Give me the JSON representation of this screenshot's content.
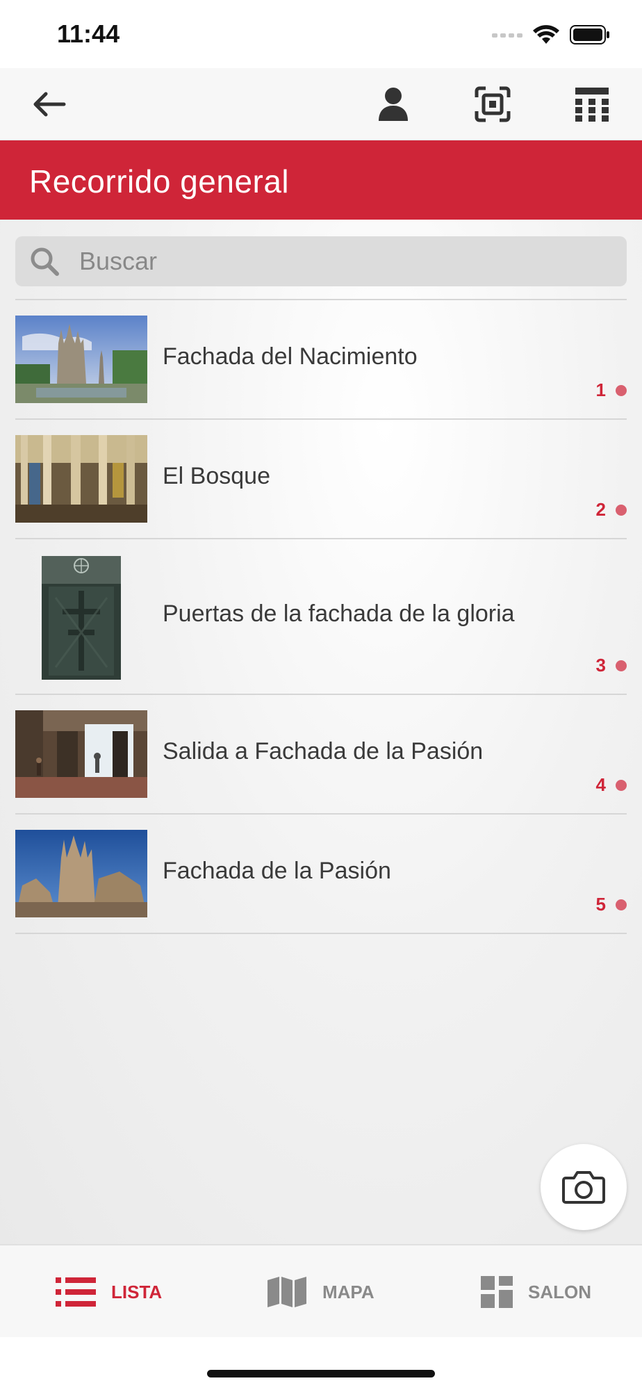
{
  "status_bar": {
    "time": "11:44"
  },
  "title_bar": {
    "title": "Recorrido general"
  },
  "search": {
    "placeholder": "Buscar"
  },
  "stops": [
    {
      "label": "Fachada del Nacimiento",
      "number": "1"
    },
    {
      "label": "El Bosque",
      "number": "2"
    },
    {
      "label": "Puertas de la fachada de la gloria",
      "number": "3"
    },
    {
      "label": "Salida a Fachada de la Pasión",
      "number": "4"
    },
    {
      "label": "Fachada de la Pasión",
      "number": "5"
    }
  ],
  "tabbar": {
    "lista": "LISTA",
    "mapa": "MAPA",
    "salon": "SALON"
  },
  "colors": {
    "accent": "#cf2538",
    "dot": "#d9606f",
    "tab_inactive": "#8a8a8a"
  }
}
